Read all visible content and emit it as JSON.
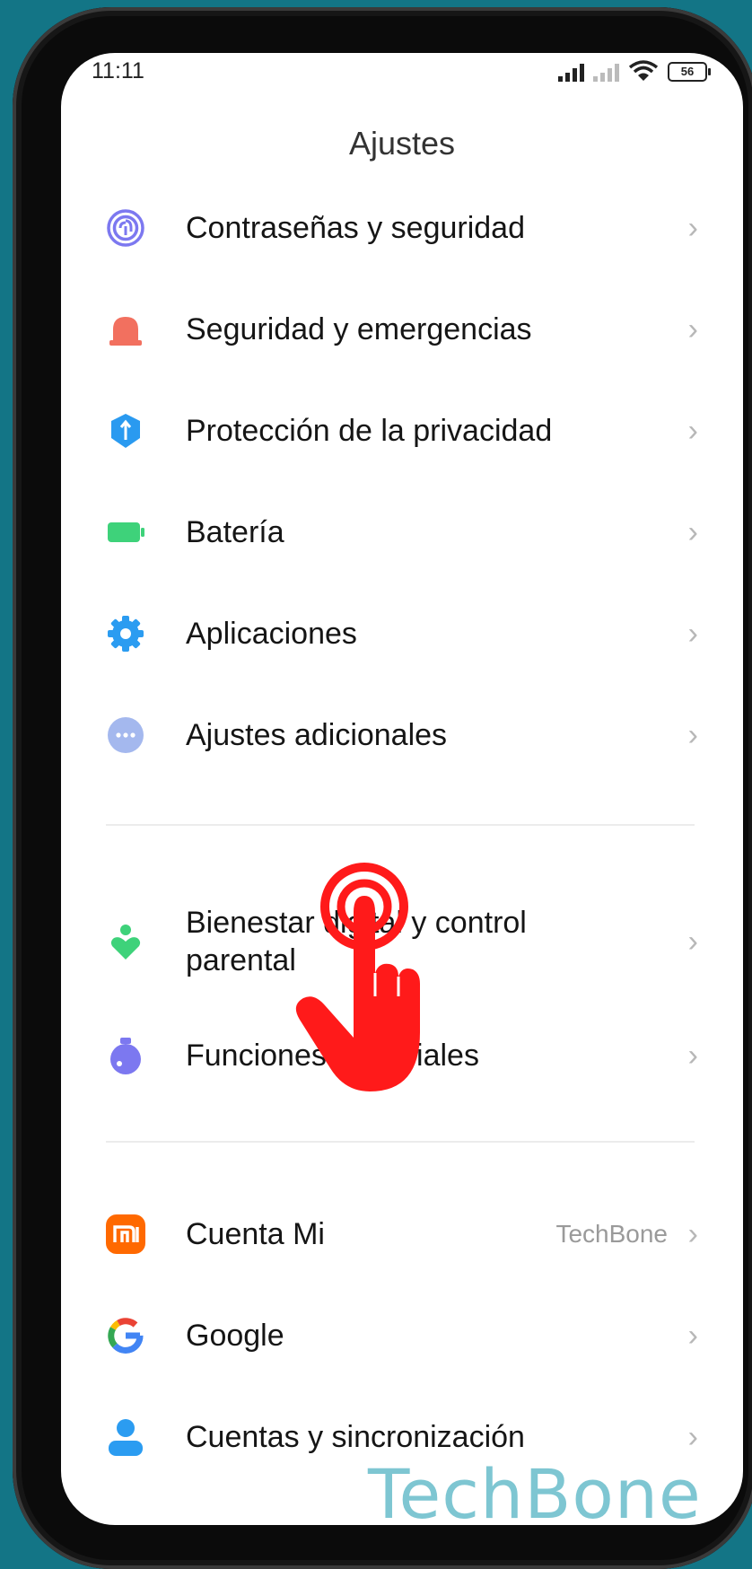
{
  "status_bar": {
    "time": "11:11",
    "battery": "56"
  },
  "header": {
    "title": "Ajustes"
  },
  "items": [
    {
      "label": "Contraseñas y seguridad",
      "icon": "fingerprint-icon"
    },
    {
      "label": "Seguridad y emergencias",
      "icon": "siren-icon"
    },
    {
      "label": "Protección de la privacidad",
      "icon": "privacy-shield-icon"
    },
    {
      "label": "Batería",
      "icon": "battery-icon"
    },
    {
      "label": "Aplicaciones",
      "icon": "gear-icon"
    },
    {
      "label": "Ajustes adicionales",
      "icon": "more-icon"
    },
    {
      "label": "Bienestar digital y control parental",
      "icon": "wellbeing-icon"
    },
    {
      "label": "Funciones especiales",
      "icon": "flask-icon"
    },
    {
      "label": "Cuenta Mi",
      "icon": "mi-icon",
      "value": "TechBone"
    },
    {
      "label": "Google",
      "icon": "google-icon"
    },
    {
      "label": "Cuentas y sincronización",
      "icon": "person-icon"
    }
  ],
  "overlay": {
    "icon": "tap-hand-icon"
  },
  "watermark": "TechBone",
  "colors": {
    "background": "#137586",
    "watermark": "#7ec6d2",
    "hand": "#ff1a1a"
  }
}
